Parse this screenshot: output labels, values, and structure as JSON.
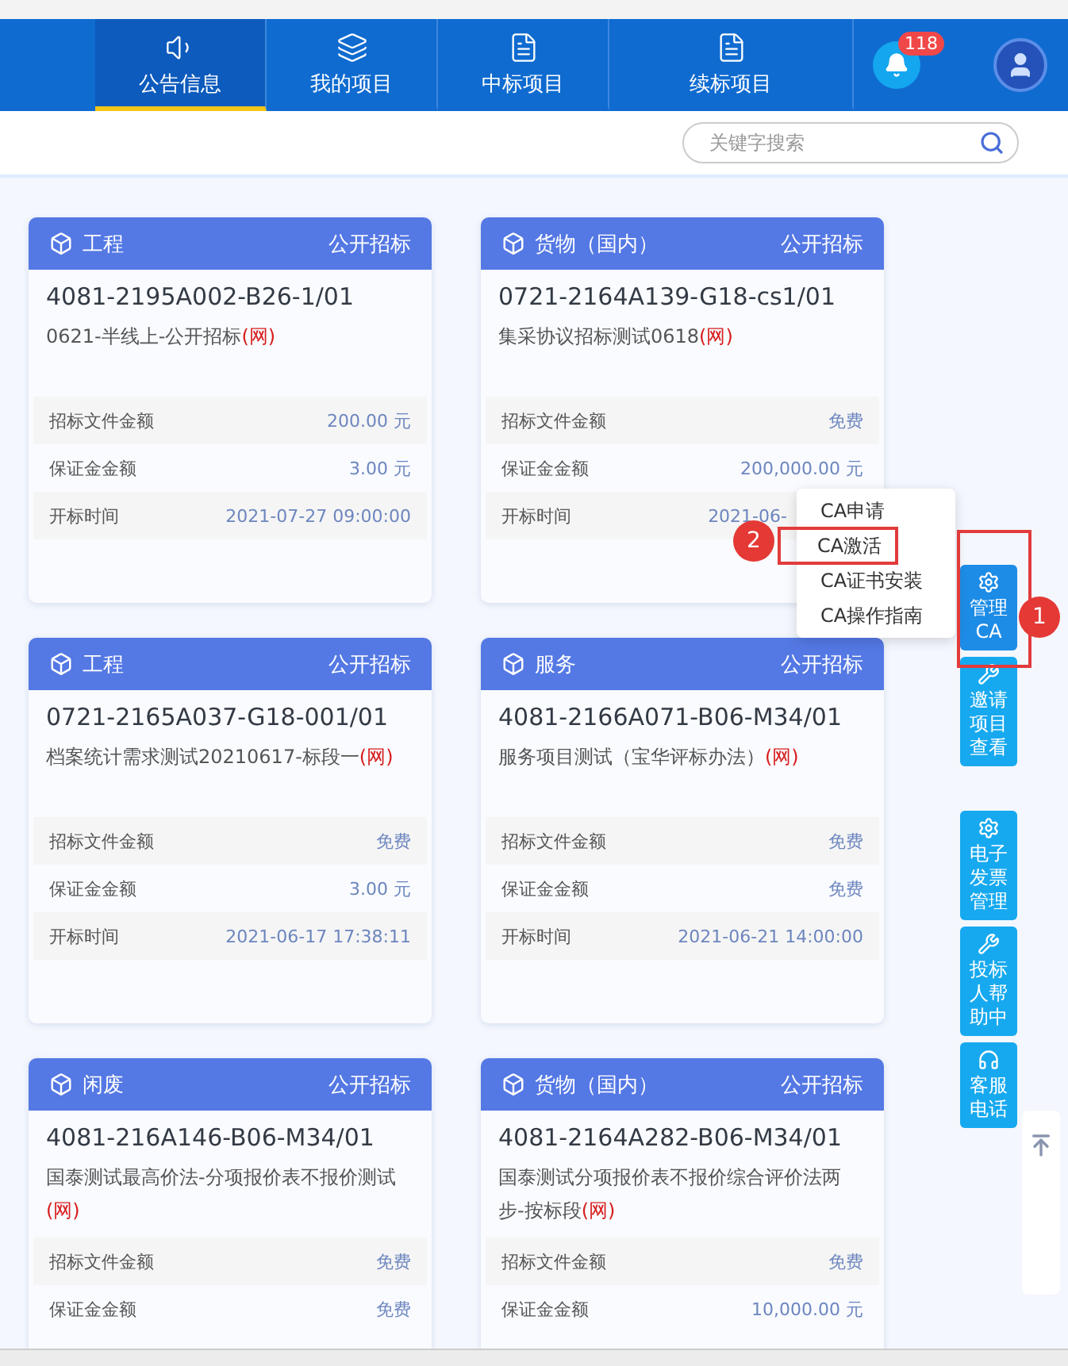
{
  "nav": {
    "tabs": [
      {
        "label": "公告信息",
        "selected": true
      },
      {
        "label": "我的项目",
        "selected": false
      },
      {
        "label": "中标项目",
        "selected": false
      },
      {
        "label": "续标项目",
        "selected": false
      }
    ],
    "notification_count": "118"
  },
  "search": {
    "placeholder": "关键字搜索"
  },
  "cards": [
    {
      "category": "工程",
      "method": "公开招标",
      "code": "4081-2195A002-B26-1/01",
      "description": "0621-半线上-公开招标",
      "mark": "(网)",
      "rows": [
        {
          "label": "招标文件金额",
          "value": "200.00 元"
        },
        {
          "label": "保证金金额",
          "value": "3.00 元"
        },
        {
          "label": "开标时间",
          "value": "2021-07-27 09:00:00"
        }
      ]
    },
    {
      "category": "货物（国内）",
      "method": "公开招标",
      "code": "0721-2164A139-G18-cs1/01",
      "description": "集采协议招标测试0618",
      "mark": "(网)",
      "rows": [
        {
          "label": "招标文件金额",
          "value": "免费"
        },
        {
          "label": "保证金金额",
          "value": "200,000.00 元"
        },
        {
          "label": "开标时间",
          "value": "2021-06-",
          "under_menu": true
        }
      ]
    },
    {
      "category": "工程",
      "method": "公开招标",
      "code": "0721-2165A037-G18-001/01",
      "description": "档案统计需求测试20210617-标段一",
      "mark": "(网)",
      "rows": [
        {
          "label": "招标文件金额",
          "value": "免费"
        },
        {
          "label": "保证金金额",
          "value": "3.00 元"
        },
        {
          "label": "开标时间",
          "value": "2021-06-17 17:38:11"
        }
      ]
    },
    {
      "category": "服务",
      "method": "公开招标",
      "code": "4081-2166A071-B06-M34/01",
      "description": "服务项目测试（宝华评标办法）",
      "mark": "(网)",
      "rows": [
        {
          "label": "招标文件金额",
          "value": "免费"
        },
        {
          "label": "保证金金额",
          "value": "免费"
        },
        {
          "label": "开标时间",
          "value": "2021-06-21 14:00:00"
        }
      ]
    },
    {
      "category": "闲废",
      "method": "公开招标",
      "code": "4081-216A146-B06-M34/01",
      "description": "国泰测试最高价法-分项报价表不报价测试",
      "mark": "(网)",
      "rows": [
        {
          "label": "招标文件金额",
          "value": "免费"
        },
        {
          "label": "保证金金额",
          "value": "免费"
        }
      ]
    },
    {
      "category": "货物（国内）",
      "method": "公开招标",
      "code": "4081-2164A282-B06-M34/01",
      "description": "国泰测试分项报价表不报价综合评价法两步-按标段",
      "mark": "(网)",
      "rows": [
        {
          "label": "招标文件金额",
          "value": "免费"
        },
        {
          "label": "保证金金额",
          "value": "10,000.00 元"
        }
      ]
    }
  ],
  "side_buttons": [
    {
      "label": "管理CA",
      "selected": true
    },
    {
      "label": "邀请项目查看",
      "selected": false
    },
    {
      "label": "电子发票管理",
      "selected": false
    },
    {
      "label": "投标人帮助中",
      "selected": false
    },
    {
      "label": "客服电话",
      "selected": false
    }
  ],
  "ca_menu": {
    "items": [
      {
        "label": "CA申请",
        "highlighted": false
      },
      {
        "label": "CA激活",
        "highlighted": true
      },
      {
        "label": "CA证书安装",
        "highlighted": false
      },
      {
        "label": "CA操作指南",
        "highlighted": false
      }
    ]
  },
  "annotations": [
    {
      "number": "2"
    },
    {
      "number": "1"
    }
  ]
}
